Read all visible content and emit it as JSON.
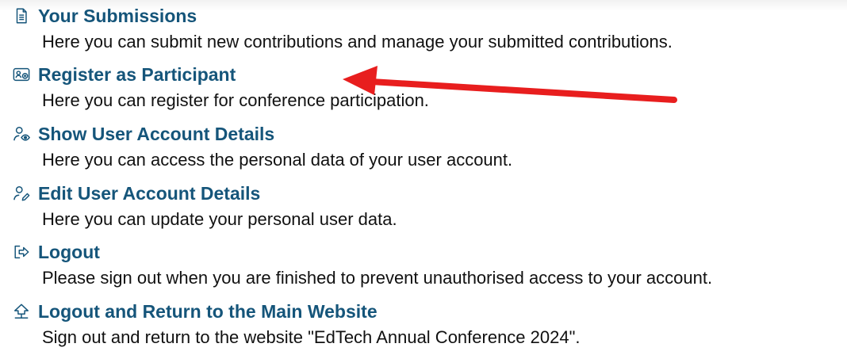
{
  "menu": {
    "items": [
      {
        "icon": "document-icon",
        "title": "Your Submissions",
        "description": "Here you can submit new contributions and manage your submitted contributions."
      },
      {
        "icon": "register-card-icon",
        "title": "Register as Participant",
        "description": "Here you can register for conference participation."
      },
      {
        "icon": "user-eye-icon",
        "title": "Show User Account Details",
        "description": "Here you can access the personal data of your user account."
      },
      {
        "icon": "user-edit-icon",
        "title": "Edit User Account Details",
        "description": "Here you can update your personal user data."
      },
      {
        "icon": "logout-icon",
        "title": "Logout",
        "description": "Please sign out when you are finished to prevent unauthorised access to your account."
      },
      {
        "icon": "home-exit-icon",
        "title": "Logout and Return to the Main Website",
        "description": "Sign out and return to the website \"EdTech Annual Conference 2024\"."
      }
    ]
  },
  "annotation": {
    "icon": "red-arrow-icon",
    "color": "#e81e1e",
    "points_to": "Register as Participant"
  },
  "colors": {
    "link": "#15557a",
    "text": "#111111",
    "background": "#ffffff"
  }
}
